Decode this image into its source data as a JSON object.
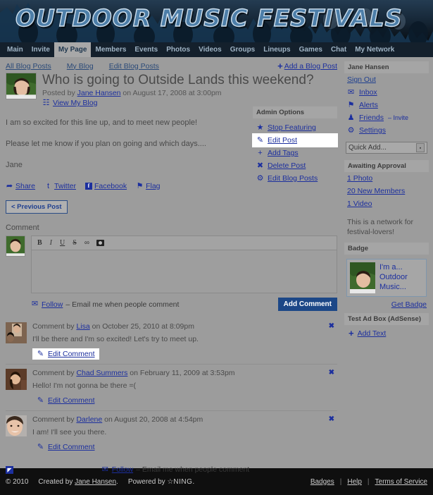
{
  "site": {
    "logo_text": "OUTDOOR MUSIC FESTIVALS"
  },
  "nav": {
    "items": [
      {
        "label": "Main",
        "active": false
      },
      {
        "label": "Invite",
        "active": false
      },
      {
        "label": "My Page",
        "active": true
      },
      {
        "label": "Members",
        "active": false
      },
      {
        "label": "Events",
        "active": false
      },
      {
        "label": "Photos",
        "active": false
      },
      {
        "label": "Videos",
        "active": false
      },
      {
        "label": "Groups",
        "active": false
      },
      {
        "label": "Lineups",
        "active": false
      },
      {
        "label": "Games",
        "active": false
      },
      {
        "label": "Chat",
        "active": false
      },
      {
        "label": "My Network",
        "active": false
      }
    ]
  },
  "blognav": {
    "all_blog_posts": "All Blog Posts",
    "my_blog": "My Blog",
    "edit_blog_posts": "Edit Blog Posts",
    "add_blog_post": "Add a Blog Post",
    "plus": "+"
  },
  "post": {
    "title": "Who is going to Outside Lands this weekend?",
    "posted_by_prefix": "Posted by ",
    "author": "Jane Hansen",
    "posted_on": " on August 17, 2008 at 3:00pm",
    "view_my_blog": "View My Blog",
    "paragraphs": [
      "I am so excited for this line up, and to meet new people!",
      "Please let me know if you plan on going and which days....",
      "Jane"
    ]
  },
  "admin": {
    "header": "Admin Options",
    "items": [
      {
        "label": "Stop Featuring",
        "icon": "star-icon",
        "glyph": "★",
        "highlighted": false
      },
      {
        "label": "Edit Post",
        "icon": "pencil-icon",
        "glyph": "✎",
        "highlighted": true
      },
      {
        "label": "Add Tags",
        "icon": "plus-icon",
        "glyph": "+",
        "highlighted": false
      },
      {
        "label": "Delete Post",
        "icon": "x-icon",
        "glyph": "✖",
        "highlighted": false
      },
      {
        "label": "Edit Blog Posts",
        "icon": "gear-icon",
        "glyph": "⚙",
        "highlighted": false
      }
    ]
  },
  "share": {
    "share": "Share",
    "twitter": "Twitter",
    "facebook": "Facebook",
    "facebook_glyph": "f",
    "flag": "Flag"
  },
  "prev_post": "< Previous Post",
  "comment_form": {
    "label": "Comment",
    "toolbar": [
      {
        "name": "bold-icon",
        "glyph": "B"
      },
      {
        "name": "italic-icon",
        "glyph": "I"
      },
      {
        "name": "underline-icon",
        "glyph": "U"
      },
      {
        "name": "strikethrough-icon",
        "glyph": "S"
      },
      {
        "name": "link-icon",
        "glyph": "∞"
      },
      {
        "name": "image-icon",
        "glyph": ""
      }
    ],
    "value": "",
    "follow_link": "Follow",
    "follow_text": "– Email me when people comment",
    "add_comment": "Add Comment"
  },
  "comments": [
    {
      "prefix": "Comment by ",
      "author": "Lisa",
      "meta": " on October 25, 2010 at 8:09pm",
      "text": "I'll be there and I'm so excited! Let's try to meet up.",
      "edit_label": "Edit Comment",
      "edit_highlighted": true,
      "delete_glyph": "✖"
    },
    {
      "prefix": "Comment by ",
      "author": "Chad Summers",
      "meta": " on February 11, 2009 at 3:53pm",
      "text": "Hello! I'm not gonna be there =(",
      "edit_label": "Edit Comment",
      "edit_highlighted": false,
      "delete_glyph": "✖"
    },
    {
      "prefix": "Comment by ",
      "author": "Darlene",
      "meta": " on August 20, 2008 at 4:54pm",
      "text": "I am! I'll see you there.",
      "edit_label": "Edit Comment",
      "edit_highlighted": false,
      "delete_glyph": "✖"
    }
  ],
  "bottom_follow": {
    "rss_glyph": "◤",
    "follow_link": "Follow",
    "follow_text": "– Email me when people comment"
  },
  "sidebar": {
    "user_header": "Jane Hansen",
    "sign_out": "Sign Out",
    "links": [
      {
        "label": "Inbox",
        "icon": "envelope-icon",
        "glyph": "✉"
      },
      {
        "label": "Alerts",
        "icon": "flag-icon",
        "glyph": "⚑"
      },
      {
        "label": "Friends",
        "suffix": " – Invite",
        "icon": "person-icon",
        "glyph": "♟"
      },
      {
        "label": "Settings",
        "icon": "gear-icon",
        "glyph": "⚙"
      }
    ],
    "quick_add": {
      "value": "Quick Add...",
      "arrow": "▪"
    },
    "awaiting_header": "Awaiting Approval",
    "awaiting": [
      "1 Photo",
      "20 New Members",
      "1 Video"
    ],
    "network_blurb": "This is a network for festival-lovers!",
    "badge_header": "Badge",
    "badge_text": "I'm a... Outdoor Music...",
    "get_badge": "Get Badge",
    "adbox_header": "Test Ad Box (AdSense)",
    "add_text": "Add Text",
    "add_text_plus": "+"
  },
  "footer": {
    "copyright": "© 2010",
    "created_by_prefix": "Created by ",
    "created_by": "Jane Hansen",
    "created_by_suffix": ".",
    "powered_by": "Powered by",
    "ning": "NING",
    "ning_suffix": ".",
    "badges": "Badges",
    "help": "Help",
    "terms": "Terms of Service",
    "sep": "|"
  },
  "colors": {
    "accent_link": "#1c2f9e",
    "banner_bg": "#0d1620",
    "nav_bg": "#14202c",
    "button_blue": "#1c4787",
    "page_bg": "#9c9c9c"
  }
}
